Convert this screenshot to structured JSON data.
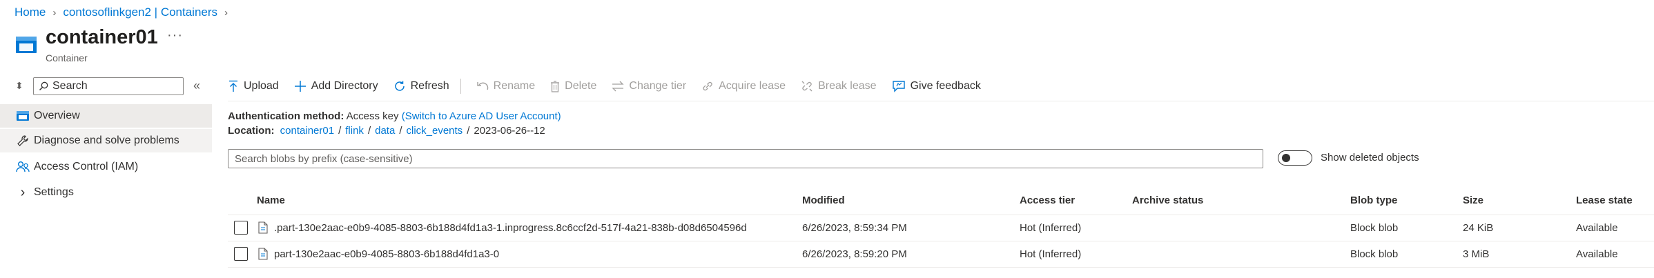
{
  "breadcrumb": {
    "home": "Home",
    "parent": "contosoflinkgen2 | Containers"
  },
  "header": {
    "title": "container01",
    "subtitle": "Container",
    "more": "···"
  },
  "sidebar": {
    "search_placeholder": "Search",
    "items": [
      {
        "label": "Overview",
        "icon": "overview-icon"
      },
      {
        "label": "Diagnose and solve problems",
        "icon": "wrench-icon"
      },
      {
        "label": "Access Control (IAM)",
        "icon": "people-icon"
      },
      {
        "label": "Settings",
        "icon": "chevron-right-icon"
      }
    ]
  },
  "toolbar": {
    "upload": "Upload",
    "add_directory": "Add Directory",
    "refresh": "Refresh",
    "rename": "Rename",
    "delete": "Delete",
    "change_tier": "Change tier",
    "acquire_lease": "Acquire lease",
    "break_lease": "Break lease",
    "give_feedback": "Give feedback"
  },
  "auth": {
    "label": "Authentication method:",
    "value": "Access key",
    "switch_link": "(Switch to Azure AD User Account)"
  },
  "location": {
    "label": "Location:",
    "path": [
      "container01",
      "flink",
      "data",
      "click_events"
    ],
    "current": "2023-06-26--12"
  },
  "blob_search": {
    "placeholder": "Search blobs by prefix (case-sensitive)"
  },
  "show_deleted": {
    "label": "Show deleted objects",
    "on": false
  },
  "table": {
    "columns": {
      "name": "Name",
      "modified": "Modified",
      "access_tier": "Access tier",
      "archive_status": "Archive status",
      "blob_type": "Blob type",
      "size": "Size",
      "lease_state": "Lease state"
    },
    "rows": [
      {
        "name": ".part-130e2aac-e0b9-4085-8803-6b188d4fd1a3-1.inprogress.8c6ccf2d-517f-4a21-838b-d08d6504596d",
        "modified": "6/26/2023, 8:59:34 PM",
        "access_tier": "Hot (Inferred)",
        "archive_status": "",
        "blob_type": "Block blob",
        "size": "24 KiB",
        "lease_state": "Available"
      },
      {
        "name": "part-130e2aac-e0b9-4085-8803-6b188d4fd1a3-0",
        "modified": "6/26/2023, 8:59:20 PM",
        "access_tier": "Hot (Inferred)",
        "archive_status": "",
        "blob_type": "Block blob",
        "size": "3 MiB",
        "lease_state": "Available"
      }
    ]
  },
  "colors": {
    "accent": "#0078d4",
    "selected_bg": "#edebe9",
    "disabled": "#a19f9d"
  }
}
